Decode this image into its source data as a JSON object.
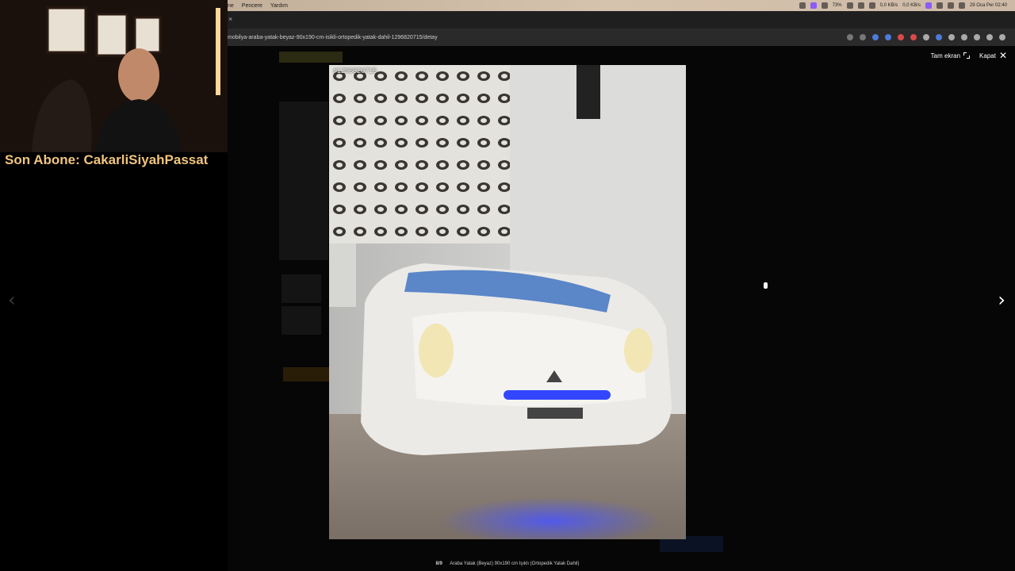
{
  "menubar": {
    "items": [
      "ne",
      "Pencere",
      "Yardım"
    ],
    "battery": "73%",
    "network_up": "0,0 KB/s",
    "network_down": "0,0 KB/s",
    "datetime": "29 Oca Per  02:40"
  },
  "browser": {
    "url": "mobilya-araba-yatak-beyaz-90x190-cm-isikli-ortopedik-yatak-dahil-1296820715/detay",
    "tab_close": "×"
  },
  "lightbox": {
    "fullscreen_label": "Tam ekran",
    "close_label": "Kapat",
    "close_glyph": "✕",
    "photo_id": "#1296820715",
    "prev_glyph": "‹",
    "next_glyph": "›",
    "counter": "8/9",
    "caption": "Araba Yatak (Beyaz) 90x190 cm Işıklı (Ortopedik Yatak Dahil)",
    "watermark": "sahibinden.com"
  },
  "overlay": {
    "subscriber_text": "Son Abone: CakarliSiyahPassat"
  },
  "colors": {
    "subscriber": "#f1c57e",
    "menubar_accent": "#8b5cf6"
  }
}
